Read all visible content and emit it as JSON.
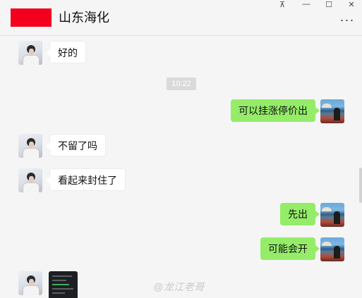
{
  "window": {
    "chat_title": "山东海化",
    "controls": {
      "pin": "⊼",
      "minimize": "—",
      "maximize": "☐",
      "close": "✕"
    },
    "more_glyph": "···"
  },
  "messages": [
    {
      "side": "in",
      "text": "好的"
    },
    {
      "type": "time",
      "text": "10:22"
    },
    {
      "side": "out",
      "text": "可以挂涨停价出"
    },
    {
      "side": "in",
      "text": "不留了吗"
    },
    {
      "side": "in",
      "text": "看起来封住了"
    },
    {
      "side": "out",
      "text": "先出"
    },
    {
      "side": "out",
      "text": "可能会开"
    }
  ],
  "watermark": "@龙江老哥",
  "colors": {
    "outgoing_bubble": "#95ec69",
    "incoming_bubble": "#ffffff",
    "redaction": "#f4001e",
    "background": "#f5f5f5"
  }
}
